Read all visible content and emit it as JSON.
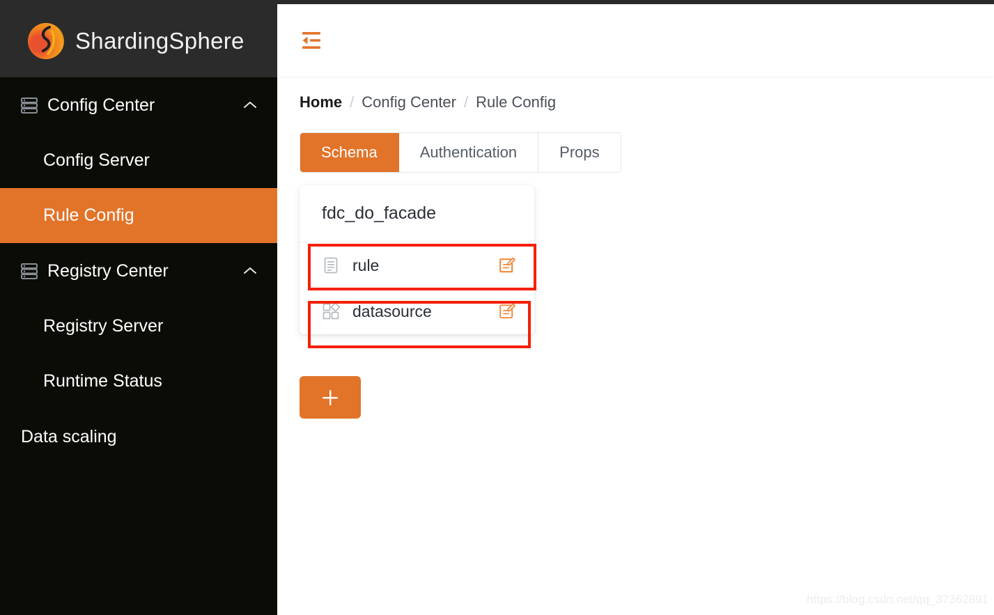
{
  "brand": {
    "name": "ShardingSphere",
    "logo_icon": "shardingsphere-flame-logo",
    "accent_color": "#e2742a",
    "sidebar_bg": "#0a0c05",
    "logo_bar_bg": "#2b2b2b"
  },
  "sidebar": {
    "groups": [
      {
        "label": "Config Center",
        "icon": "database-stack-icon",
        "chevron": "chevron-up-icon",
        "expanded": true,
        "items": [
          {
            "label": "Config Server",
            "active": false
          },
          {
            "label": "Rule Config",
            "active": true
          }
        ]
      },
      {
        "label": "Registry Center",
        "icon": "database-stack-icon",
        "chevron": "chevron-up-icon",
        "expanded": true,
        "items": [
          {
            "label": "Registry Server",
            "active": false
          },
          {
            "label": "Runtime Status",
            "active": false
          }
        ]
      }
    ],
    "standalone": [
      {
        "label": "Data scaling",
        "active": false
      }
    ]
  },
  "topbar": {
    "fold_icon": "menu-fold-icon",
    "fold_color": "#e2742a"
  },
  "breadcrumb": {
    "separator": "/",
    "items": [
      {
        "label": "Home",
        "current": false
      },
      {
        "label": "Config Center",
        "current": false
      },
      {
        "label": "Rule Config",
        "current": true
      }
    ]
  },
  "tabs": [
    {
      "label": "Schema",
      "active": true
    },
    {
      "label": "Authentication",
      "active": false
    },
    {
      "label": "Props",
      "active": false
    }
  ],
  "schema_card": {
    "title": "fdc_do_facade",
    "rows": [
      {
        "label": "rule",
        "icon": "profile-document-icon",
        "edit_icon": "form-edit-icon",
        "highlighted": true
      },
      {
        "label": "datasource",
        "icon": "appstore-blocks-icon",
        "edit_icon": "form-edit-icon",
        "highlighted": true
      }
    ]
  },
  "add_button": {
    "icon": "plus-icon",
    "label": "+"
  },
  "watermark": {
    "text": "https://blog.csdn.net/qq_37362891"
  }
}
